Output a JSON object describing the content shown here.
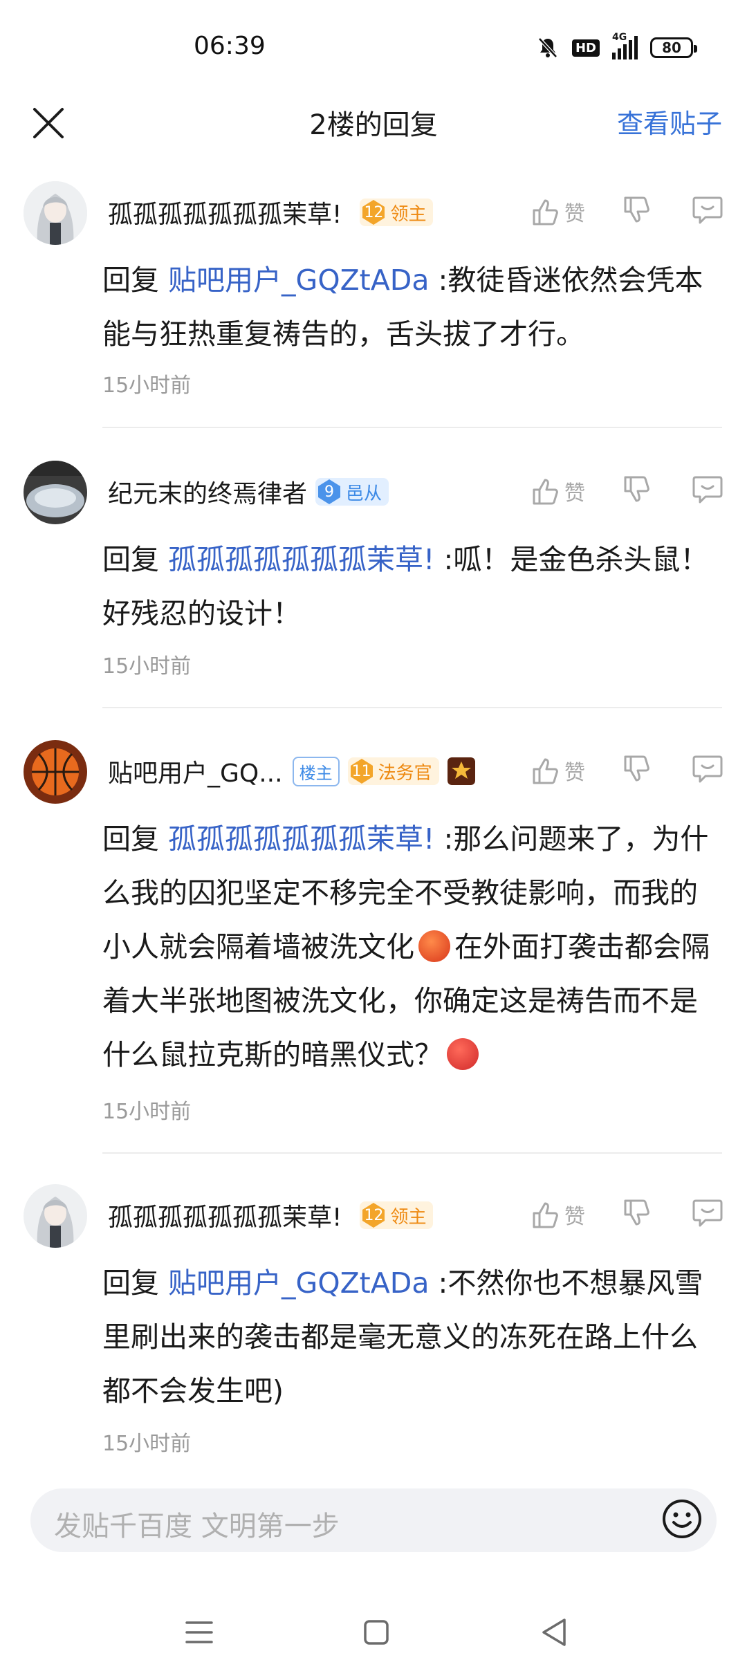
{
  "status_bar": {
    "time": "06:39",
    "hd_label": "HD",
    "network_label": "4G",
    "battery": "80"
  },
  "header": {
    "title": "2楼的回复",
    "view_post": "查看贴子"
  },
  "comments": [
    {
      "username": "孤孤孤孤孤孤孤茉草!",
      "level": "12",
      "level_title": "领主",
      "like_label": "赞",
      "reply_prefix": "回复 ",
      "mention": "贴吧用户_GQZtADa",
      "text": " :教徒昏迷依然会凭本能与狂热重复祷告的，舌头拔了才行。",
      "time": "15小时前"
    },
    {
      "username": "纪元末的终焉律者",
      "level": "9",
      "level_title": "邑从",
      "like_label": "赞",
      "reply_prefix": "回复 ",
      "mention": "孤孤孤孤孤孤孤茉草!",
      "text": " :呱！是金色杀头鼠！好残忍的设计！",
      "time": "15小时前"
    },
    {
      "username": "贴吧用户_GQ...",
      "op_tag": "楼主",
      "level": "11",
      "level_title": "法务官",
      "like_label": "赞",
      "reply_prefix": "回复 ",
      "mention": "孤孤孤孤孤孤孤茉草!",
      "text_part1": " :那么问题来了，为什么我的囚犯坚定不移完全不受教徒影响，而我的小人就会隔着墙被洗文化",
      "text_part2": "在外面打袭击都会隔着大半张地图被洗文化，你确定这是祷告而不是什么鼠拉克斯的暗黑仪式？",
      "time": "15小时前"
    },
    {
      "username": "孤孤孤孤孤孤孤茉草!",
      "level": "12",
      "level_title": "领主",
      "like_label": "赞",
      "reply_prefix": "回复 ",
      "mention": "贴吧用户_GQZtADa",
      "text": " :不然你也不想暴风雪里刷出来的袭击都是毫无意义的冻死在路上什么都不会发生吧)",
      "time": "15小时前"
    }
  ],
  "input_bar": {
    "placeholder": "发贴千百度 文明第一步"
  },
  "colors": {
    "link": "#3763c7",
    "accent": "#3772d8",
    "gold_badge": "#ee8a12",
    "blue_badge": "#3d8ae6"
  }
}
